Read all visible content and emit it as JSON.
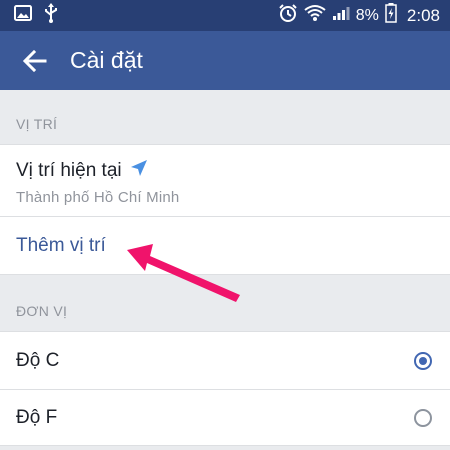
{
  "status_bar": {
    "battery_percent": "8%",
    "time": "2:08",
    "left_icons": [
      "image-icon",
      "usb-icon"
    ],
    "right_icons": [
      "alarm-icon",
      "wifi-icon",
      "signal-icon",
      "battery-charging-icon"
    ]
  },
  "app_bar": {
    "title": "Cài đặt",
    "back_icon": "arrow-left-icon"
  },
  "sections": {
    "location": {
      "header": "VỊ TRÍ",
      "current_location_title": "Vị trí hiện tại",
      "current_location_value": "Thành phố Hồ Chí Minh",
      "add_location_label": "Thêm vị trí"
    },
    "units": {
      "header": "ĐƠN VỊ",
      "options": [
        {
          "label": "Độ C",
          "selected": true
        },
        {
          "label": "Độ F",
          "selected": false
        }
      ]
    }
  },
  "colors": {
    "status_bar": "#283f74",
    "app_bar": "#3b5998",
    "link": "#3b5998",
    "accent": "#4267b2",
    "annotation_arrow": "#f0136b",
    "location_icon": "#4a90e2"
  }
}
